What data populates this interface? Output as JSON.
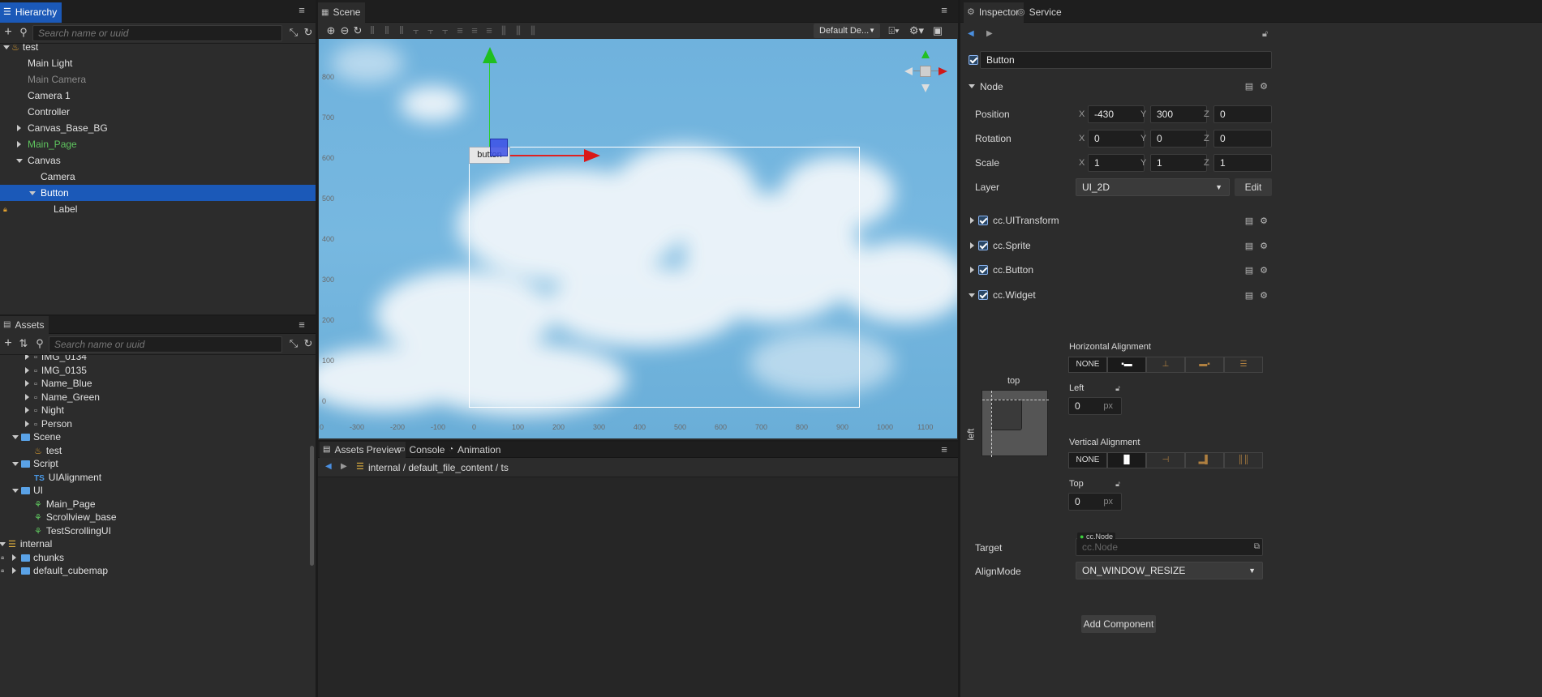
{
  "colors": {
    "accent": "#1b59b8",
    "green": "#5ec45e",
    "scene_sky": "#6fb1dc"
  },
  "hierarchy": {
    "tab": "Hierarchy",
    "search_placeholder": "Search name or uuid",
    "nodes": [
      {
        "label": "test",
        "icon": "scene-fire-icon",
        "depth": 0,
        "expanded": true
      },
      {
        "label": "Main Light",
        "depth": 1
      },
      {
        "label": "Main Camera",
        "depth": 1,
        "dim": true
      },
      {
        "label": "Camera 1",
        "depth": 1
      },
      {
        "label": "Controller",
        "depth": 1
      },
      {
        "label": "Canvas_Base_BG",
        "depth": 1,
        "collapsed": true
      },
      {
        "label": "Main_Page",
        "depth": 1,
        "collapsed": true,
        "prefab": true
      },
      {
        "label": "Canvas",
        "depth": 1,
        "expanded": true
      },
      {
        "label": "Camera",
        "depth": 2
      },
      {
        "label": "Button",
        "depth": 2,
        "expanded": true,
        "selected": true
      },
      {
        "label": "Label",
        "depth": 3,
        "locked": true
      }
    ]
  },
  "assets": {
    "tab": "Assets",
    "search_placeholder": "Search name or uuid",
    "items": [
      {
        "label": "IMG_0134",
        "depth": 1,
        "collapsed": true,
        "icon": "image-icon"
      },
      {
        "label": "IMG_0135",
        "depth": 1,
        "collapsed": true,
        "icon": "image-icon"
      },
      {
        "label": "Name_Blue",
        "depth": 1,
        "collapsed": true,
        "icon": "image-icon"
      },
      {
        "label": "Name_Green",
        "depth": 1,
        "collapsed": true,
        "icon": "image-icon"
      },
      {
        "label": "Night",
        "depth": 1,
        "collapsed": true,
        "icon": "image-icon"
      },
      {
        "label": "Person",
        "depth": 1,
        "collapsed": true,
        "icon": "image-icon"
      },
      {
        "label": "Scene",
        "depth": 0,
        "expanded": true,
        "icon": "folder-icon"
      },
      {
        "label": "test",
        "depth": 1,
        "icon": "scene-fire-icon"
      },
      {
        "label": "Script",
        "depth": 0,
        "expanded": true,
        "icon": "folder-icon"
      },
      {
        "label": "UIAlignment",
        "depth": 1,
        "icon": "ts-icon"
      },
      {
        "label": "UI",
        "depth": 0,
        "expanded": true,
        "icon": "folder-icon"
      },
      {
        "label": "Main_Page",
        "depth": 1,
        "icon": "prefab-icon"
      },
      {
        "label": "Scrollview_base",
        "depth": 1,
        "icon": "prefab-icon"
      },
      {
        "label": "TestScrollingUI",
        "depth": 1,
        "icon": "prefab-icon"
      },
      {
        "label": "internal",
        "depth": -1,
        "expanded": true,
        "icon": "db-icon"
      },
      {
        "label": "chunks",
        "depth": 0,
        "collapsed": true,
        "icon": "folder-icon",
        "locked": true
      },
      {
        "label": "default_cubemap",
        "depth": 0,
        "collapsed": true,
        "icon": "folder-icon",
        "locked": true
      }
    ]
  },
  "scene": {
    "tab": "Scene",
    "camera_select": "Default De...",
    "button_label": "button",
    "y_ticks": [
      "800",
      "700",
      "600",
      "500",
      "400",
      "300",
      "200",
      "100",
      "0"
    ],
    "x_ticks": [
      "0",
      "-300",
      "-200",
      "-100",
      "0",
      "100",
      "200",
      "300",
      "400",
      "500",
      "600",
      "700",
      "800",
      "900",
      "1000",
      "1100"
    ]
  },
  "bottom": {
    "tabs": [
      "Assets Preview",
      "Console",
      "Animation"
    ],
    "path": [
      "internal",
      "default_file_content",
      "ts"
    ]
  },
  "inspector": {
    "tabs": [
      "Inspector",
      "Service"
    ],
    "node_name": "Button",
    "section_node": "Node",
    "position": {
      "label": "Position",
      "x": "-430",
      "y": "300",
      "z": "0"
    },
    "rotation": {
      "label": "Rotation",
      "x": "0",
      "y": "0",
      "z": "0"
    },
    "scale": {
      "label": "Scale",
      "x": "1",
      "y": "1",
      "z": "1"
    },
    "axis_x": "X",
    "axis_y": "Y",
    "axis_z": "Z",
    "layer": {
      "label": "Layer",
      "value": "UI_2D",
      "edit": "Edit"
    },
    "components": [
      "cc.UITransform",
      "cc.Sprite",
      "cc.Button",
      "cc.Widget"
    ],
    "widget": {
      "h_align_label": "Horizontal Alignment",
      "none": "NONE",
      "left_label": "Left",
      "left_value": "0",
      "unit": "px",
      "v_align_label": "Vertical Alignment",
      "top_label": "Top",
      "top_value": "0",
      "diagram_top": "top",
      "diagram_left": "left",
      "target_label": "Target",
      "target_tag": "cc.Node",
      "target_placeholder": "cc.Node",
      "align_mode_label": "AlignMode",
      "align_mode_value": "ON_WINDOW_RESIZE"
    },
    "add_component": "Add Component"
  }
}
